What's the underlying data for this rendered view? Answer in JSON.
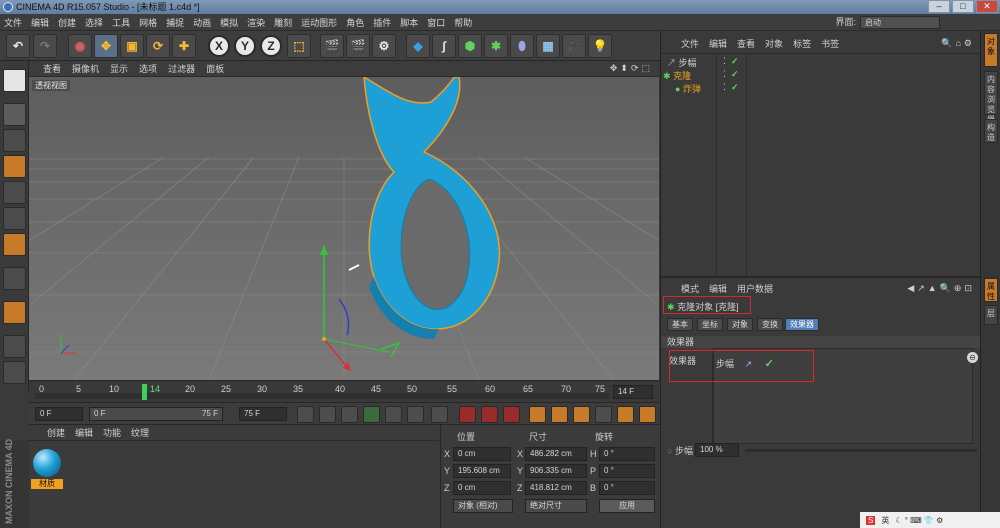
{
  "window": {
    "title": "CINEMA 4D R15.057 Studio - [未标题 1.c4d *]"
  },
  "menubar": [
    "文件",
    "编辑",
    "创建",
    "选择",
    "工具",
    "网格",
    "捕捉",
    "动画",
    "模拟",
    "渲染",
    "雕刻",
    "运动图形",
    "角色",
    "插件",
    "脚本",
    "窗口",
    "帮助"
  ],
  "layout": {
    "label": "界面:",
    "value": "启动"
  },
  "toolbar": {
    "axis_x": "X",
    "axis_y": "Y",
    "axis_z": "Z"
  },
  "viewport": {
    "menu": [
      "查看",
      "摄像机",
      "显示",
      "选项",
      "过滤器",
      "面板"
    ],
    "label": "透视视图"
  },
  "timeline": {
    "ticks": [
      "0",
      "5",
      "10",
      "14",
      "20",
      "25",
      "30",
      "35",
      "40",
      "45",
      "50",
      "55",
      "60",
      "65",
      "70",
      "75"
    ],
    "current_frame": "14 F"
  },
  "transport": {
    "start": "0 F",
    "range_start": "0 F",
    "range_end": "75 F",
    "end": "75 F"
  },
  "material": {
    "menu": [
      "创建",
      "编辑",
      "功能",
      "纹理"
    ],
    "item_label": "材质"
  },
  "coords": {
    "headers": [
      "位置",
      "尺寸",
      "旋转"
    ],
    "rows": [
      {
        "axis": "X",
        "pos": "0 cm",
        "size_axis": "X",
        "size": "486.282 cm",
        "rot_axis": "H",
        "rot": "0 °"
      },
      {
        "axis": "Y",
        "pos": "195.608 cm",
        "size_axis": "Y",
        "size": "906.335 cm",
        "rot_axis": "P",
        "rot": "0 °"
      },
      {
        "axis": "Z",
        "pos": "0 cm",
        "size_axis": "Z",
        "size": "418.812 cm",
        "rot_axis": "B",
        "rot": "0 °"
      }
    ],
    "mode": "对象 (相对)",
    "size_mode": "绝对尺寸",
    "apply": "应用"
  },
  "object_manager": {
    "menu": [
      "文件",
      "编辑",
      "查看",
      "对象",
      "标签",
      "书签"
    ],
    "objects": [
      {
        "name": "步幅"
      },
      {
        "name": "克隆"
      },
      {
        "name": "炸弹"
      }
    ]
  },
  "attributes": {
    "menu": [
      "模式",
      "编辑",
      "用户数据"
    ],
    "object_title": "克隆对象 [克隆]",
    "tabs": [
      "基本",
      "坐标",
      "对象",
      "变换",
      "效果器"
    ],
    "section": "效果器",
    "effector_label": "效果器",
    "effector_item": "步幅",
    "strength_label": "步幅",
    "strength_value": "100 %"
  },
  "side_tabs": [
    "对象",
    "内容浏览器",
    "构造",
    "属性",
    "层"
  ],
  "brand": {
    "line1": "MAXON",
    "line2": "CINEMA 4D"
  },
  "tray": {
    "ime": "英"
  },
  "colors": {
    "accent": "#4f7fb8",
    "object": "#1e9fd6",
    "outline": "#f0a020",
    "highlight": "#d62a2a"
  }
}
